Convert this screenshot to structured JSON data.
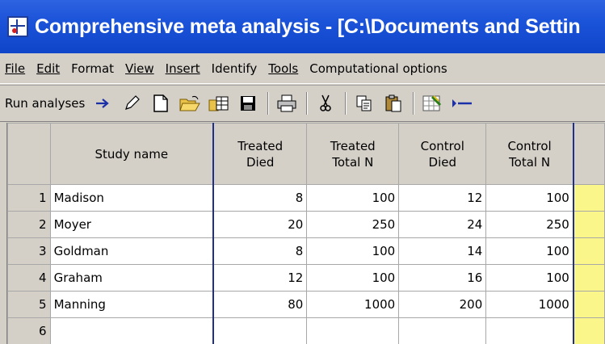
{
  "window": {
    "title": "Comprehensive meta analysis - [C:\\Documents and Settin"
  },
  "menu": {
    "items": [
      {
        "key": "file",
        "label": "File"
      },
      {
        "key": "edit",
        "label": "Edit"
      },
      {
        "key": "format",
        "label": "Format"
      },
      {
        "key": "view",
        "label": "View"
      },
      {
        "key": "insert",
        "label": "Insert"
      },
      {
        "key": "identify",
        "label": "Identify"
      },
      {
        "key": "tools",
        "label": "Tools"
      },
      {
        "key": "computational",
        "label": "Computational options"
      }
    ]
  },
  "toolbar": {
    "run_label": "Run analyses",
    "icons": [
      "arrow-right-icon",
      "pencil-icon",
      "new-document-icon",
      "open-folder-icon",
      "open-table-icon",
      "save-icon",
      "print-icon",
      "cut-icon",
      "copy-icon",
      "paste-icon",
      "formula-icon",
      "insert-row-icon"
    ]
  },
  "grid": {
    "columns": [
      {
        "line1": "Study name",
        "line2": ""
      },
      {
        "line1": "Treated",
        "line2": "Died"
      },
      {
        "line1": "Treated",
        "line2": "Total N"
      },
      {
        "line1": "Control",
        "line2": "Died"
      },
      {
        "line1": "Control",
        "line2": "Total N"
      }
    ],
    "rows": [
      {
        "num": "1",
        "name": "Madison",
        "treated_died": "8",
        "treated_total": "100",
        "control_died": "12",
        "control_total": "100"
      },
      {
        "num": "2",
        "name": "Moyer",
        "treated_died": "20",
        "treated_total": "250",
        "control_died": "24",
        "control_total": "250"
      },
      {
        "num": "3",
        "name": "Goldman",
        "treated_died": "8",
        "treated_total": "100",
        "control_died": "14",
        "control_total": "100"
      },
      {
        "num": "4",
        "name": "Graham",
        "treated_died": "12",
        "treated_total": "100",
        "control_died": "16",
        "control_total": "100"
      },
      {
        "num": "5",
        "name": "Manning",
        "treated_died": "80",
        "treated_total": "1000",
        "control_died": "200",
        "control_total": "1000"
      },
      {
        "num": "6",
        "name": "",
        "treated_died": "",
        "treated_total": "",
        "control_died": "",
        "control_total": ""
      }
    ]
  },
  "colors": {
    "titlebar": "#1b53d9",
    "chrome": "#d4d0c8",
    "highlight_column": "#fbf68a",
    "divider_line": "#1f2f8a"
  }
}
